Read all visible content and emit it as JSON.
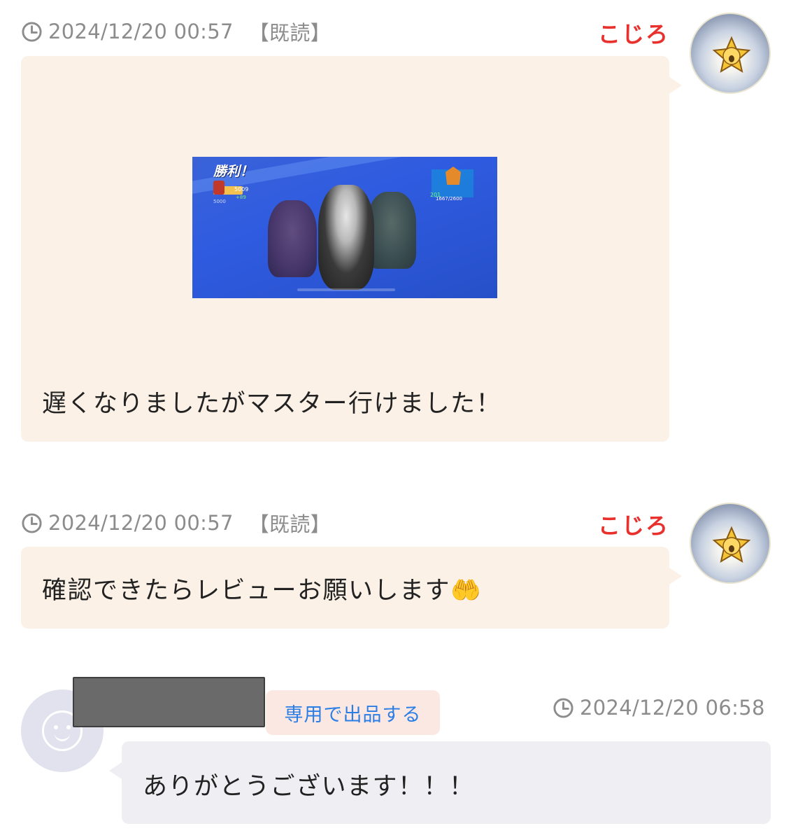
{
  "messages": [
    {
      "timestamp": "2024/12/20 00:57",
      "read_label": "【既読】",
      "sender": "こじろ",
      "attachment": "game-victory-screenshot",
      "text": "遅くなりましたがマスター行けました！"
    },
    {
      "timestamp": "2024/12/20 00:57",
      "read_label": "【既読】",
      "sender": "こじろ",
      "text": "確認できたらレビューお願いします🤲"
    },
    {
      "timestamp": "2024/12/20 06:58",
      "button_label": "専用で出品する",
      "text": "ありがとうございます！！！"
    }
  ],
  "screenshot": {
    "victory_text": "勝利！",
    "rank_value": "5009",
    "rank_change": "+89",
    "rank_left": "5000",
    "trophy_value": "201",
    "progress_text": "1667/2600"
  },
  "colors": {
    "sender_name": "#e8312d",
    "my_bubble": "#fbf1e7",
    "their_bubble": "#efeff3",
    "button_text": "#2a7ee6",
    "button_bg": "#fbe8e2"
  }
}
